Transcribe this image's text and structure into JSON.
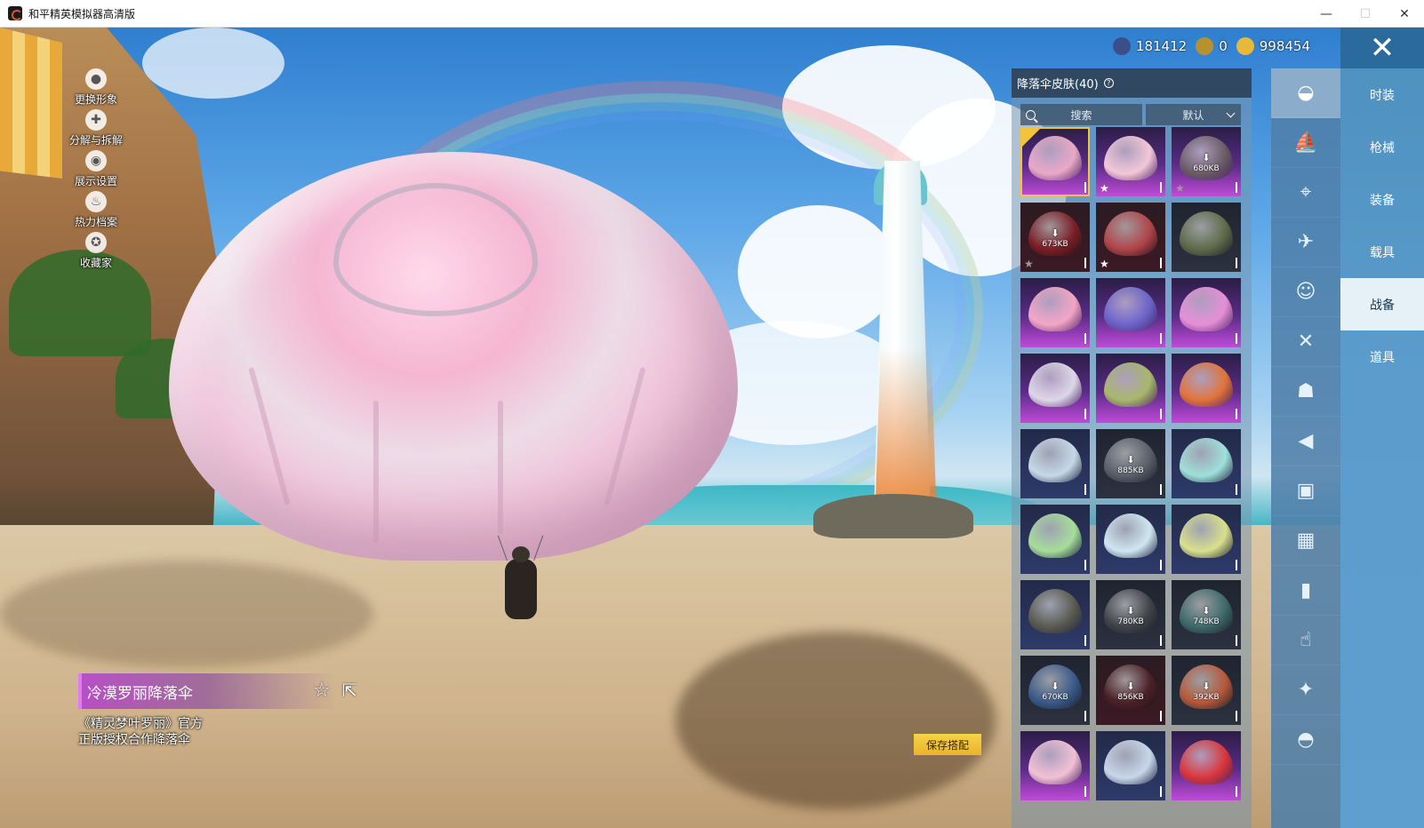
{
  "window": {
    "title": "和平精英模拟器高清版",
    "controls": {
      "minimize": "—",
      "maximize": "☐",
      "close": "✕"
    }
  },
  "side_menu": [
    {
      "label": "更换形象",
      "icon": "person-icon"
    },
    {
      "label": "分解与拆解",
      "icon": "puzzle-icon"
    },
    {
      "label": "展示设置",
      "icon": "eye-icon"
    },
    {
      "label": "热力档案",
      "icon": "flame-icon"
    },
    {
      "label": "收藏家",
      "icon": "medal-icon"
    }
  ],
  "currency": [
    {
      "value": "181412",
      "icon": "globe-coin-icon",
      "color": "#3a4f8a"
    },
    {
      "value": "0",
      "icon": "a-coin-icon",
      "color": "#b8912f"
    },
    {
      "value": "998454",
      "icon": "gold-coin-icon",
      "color": "#e6b93a"
    }
  ],
  "close_label": "✕",
  "categories": [
    {
      "label": "时装",
      "active": false
    },
    {
      "label": "枪械",
      "active": false
    },
    {
      "label": "装备",
      "active": false
    },
    {
      "label": "载具",
      "active": false
    },
    {
      "label": "战备",
      "active": true
    },
    {
      "label": "道具",
      "active": false
    }
  ],
  "icon_tabs": [
    {
      "icon": "parachute-icon",
      "glyph": "◒",
      "active": true
    },
    {
      "icon": "boat-icon",
      "glyph": "⛵",
      "active": false
    },
    {
      "icon": "drone-icon",
      "glyph": "⌖",
      "active": false
    },
    {
      "icon": "plane-icon",
      "glyph": "✈",
      "active": false
    },
    {
      "icon": "face-icon",
      "glyph": "☺",
      "active": false
    },
    {
      "icon": "glider-icon",
      "glyph": "✕",
      "active": false
    },
    {
      "icon": "robot-icon",
      "glyph": "☗",
      "active": false
    },
    {
      "icon": "speaker-icon",
      "glyph": "◀",
      "active": false
    },
    {
      "icon": "chat-icon",
      "glyph": "▣",
      "active": false
    },
    {
      "icon": "picture-icon",
      "glyph": "▦",
      "active": false
    },
    {
      "icon": "spray-icon",
      "glyph": "▮",
      "active": false
    },
    {
      "icon": "tap-icon",
      "glyph": "☝",
      "active": false
    },
    {
      "icon": "wand-icon",
      "glyph": "✦",
      "active": false
    },
    {
      "icon": "food-icon",
      "glyph": "◓",
      "active": false
    }
  ],
  "panel": {
    "title": "降落伞皮肤(40)",
    "help": "?",
    "search_placeholder": "搜索",
    "sort_label": "默认"
  },
  "skins": [
    {
      "bg": "purple",
      "chute": "#e9a8c6",
      "selected": true,
      "star": "",
      "download": ""
    },
    {
      "bg": "purple",
      "chute": "#f2c7d6",
      "selected": false,
      "star": "white",
      "download": ""
    },
    {
      "bg": "purple",
      "chute": "#6a5b66",
      "selected": false,
      "star": "gray",
      "download": "680KB"
    },
    {
      "bg": "red",
      "chute": "#7a1e26",
      "selected": false,
      "star": "gray",
      "download": "673KB"
    },
    {
      "bg": "red",
      "chute": "#b0454a",
      "selected": false,
      "star": "white",
      "download": ""
    },
    {
      "bg": "dark",
      "chute": "#5f6a4a",
      "selected": false,
      "star": "",
      "download": ""
    },
    {
      "bg": "purple",
      "chute": "#f3a5c5",
      "selected": false,
      "star": "",
      "download": ""
    },
    {
      "bg": "purple",
      "chute": "#6b63c9",
      "selected": false,
      "star": "",
      "download": ""
    },
    {
      "bg": "purple",
      "chute": "#e58fd6",
      "selected": false,
      "star": "",
      "download": ""
    },
    {
      "bg": "purple",
      "chute": "#ddd6e8",
      "selected": false,
      "star": "",
      "download": ""
    },
    {
      "bg": "purple",
      "chute": "#a7b76a",
      "selected": false,
      "star": "",
      "download": ""
    },
    {
      "bg": "purple",
      "chute": "#e0733a",
      "selected": false,
      "star": "",
      "download": ""
    },
    {
      "bg": "blue",
      "chute": "#c6d8e8",
      "selected": false,
      "star": "",
      "download": ""
    },
    {
      "bg": "dark",
      "chute": "#5a5f6a",
      "selected": false,
      "star": "",
      "download": "885KB"
    },
    {
      "bg": "blue",
      "chute": "#9fe0da",
      "selected": false,
      "star": "",
      "download": ""
    },
    {
      "bg": "blue",
      "chute": "#a6dd9a",
      "selected": false,
      "star": "",
      "download": ""
    },
    {
      "bg": "blue",
      "chute": "#cfe6f0",
      "selected": false,
      "star": "",
      "download": ""
    },
    {
      "bg": "blue",
      "chute": "#d9e08a",
      "selected": false,
      "star": "",
      "download": ""
    },
    {
      "bg": "blue",
      "chute": "#5a5a50",
      "selected": false,
      "star": "",
      "download": ""
    },
    {
      "bg": "dark",
      "chute": "#404448",
      "selected": false,
      "star": "",
      "download": "780KB"
    },
    {
      "bg": "dark",
      "chute": "#3e6a6a",
      "selected": false,
      "star": "",
      "download": "748KB"
    },
    {
      "bg": "dark",
      "chute": "#3a5a8a",
      "selected": false,
      "star": "",
      "download": "670KB"
    },
    {
      "bg": "red",
      "chute": "#4a2228",
      "selected": false,
      "star": "",
      "download": "856KB"
    },
    {
      "bg": "dark",
      "chute": "#b5593a",
      "selected": false,
      "star": "",
      "download": "392KB"
    },
    {
      "bg": "purple",
      "chute": "#f1c0d3",
      "selected": false,
      "star": "",
      "download": ""
    },
    {
      "bg": "blue",
      "chute": "#c8d6ea",
      "selected": false,
      "star": "",
      "download": ""
    },
    {
      "bg": "purple",
      "chute": "#d9353a",
      "selected": false,
      "star": "",
      "download": ""
    }
  ],
  "item": {
    "name": "冷漠罗丽降落伞",
    "desc_line1": "《精灵梦叶罗丽》官方",
    "desc_line2": "正版授权合作降落伞"
  },
  "save_label": "保存搭配"
}
